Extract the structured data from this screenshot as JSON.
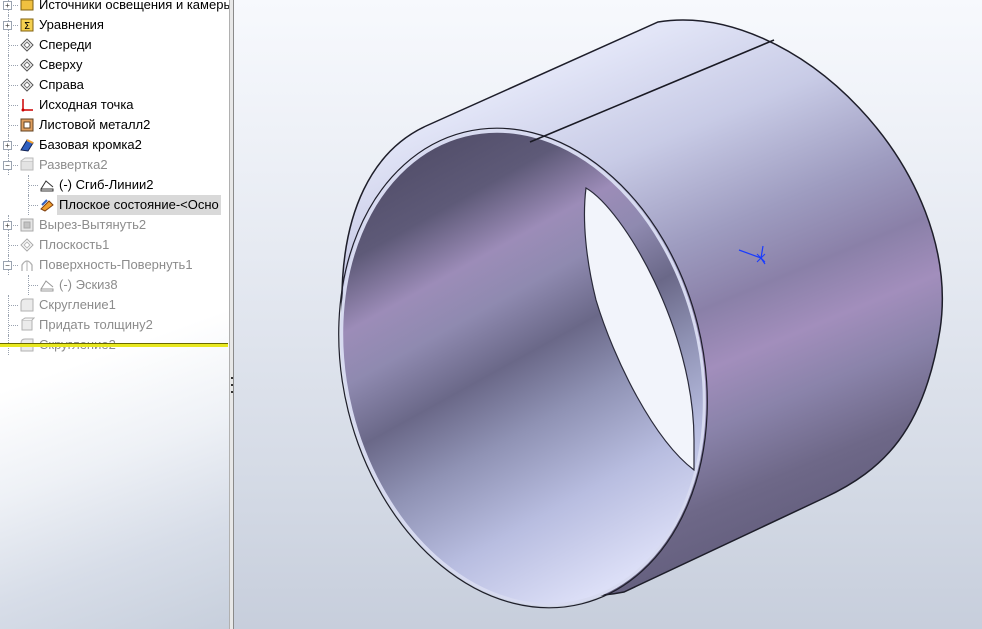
{
  "tree": {
    "items": [
      {
        "label": "Источники освещения и камеры",
        "icon": "folder-lights-icon",
        "expandable": true,
        "suppressed": false
      },
      {
        "label": "Уравнения",
        "icon": "equations-icon",
        "expandable": true,
        "suppressed": false
      },
      {
        "label": "Спереди",
        "icon": "plane-icon",
        "expandable": false,
        "suppressed": false
      },
      {
        "label": "Сверху",
        "icon": "plane-icon",
        "expandable": false,
        "suppressed": false
      },
      {
        "label": "Справа",
        "icon": "plane-icon",
        "expandable": false,
        "suppressed": false
      },
      {
        "label": "Исходная точка",
        "icon": "origin-icon",
        "expandable": false,
        "suppressed": false
      },
      {
        "label": "Листовой металл2",
        "icon": "sheet-metal-icon",
        "expandable": false,
        "suppressed": false
      },
      {
        "label": "Базовая кромка2",
        "icon": "base-flange-icon",
        "expandable": true,
        "suppressed": false
      },
      {
        "label": "Развертка2",
        "icon": "flatten-icon",
        "expandable": true,
        "expanded": true,
        "suppressed": true
      },
      {
        "label": "(-) Сгиб-Линии2",
        "icon": "sketch-icon",
        "expandable": false,
        "suppressed": false,
        "child": true
      },
      {
        "label": "Плоское состояние-<Осно",
        "icon": "flat-pattern-icon",
        "expandable": false,
        "suppressed": false,
        "child": true,
        "selected": true
      },
      {
        "label": "Вырез-Вытянуть2",
        "icon": "extruded-cut-icon",
        "expandable": true,
        "suppressed": true
      },
      {
        "label": "Плоскость1",
        "icon": "plane-icon",
        "expandable": false,
        "suppressed": true
      },
      {
        "label": "Поверхность-Повернуть1",
        "icon": "revolve-surface-icon",
        "expandable": true,
        "expanded": true,
        "suppressed": true
      },
      {
        "label": "(-) Эскиз8",
        "icon": "sketch-icon",
        "expandable": false,
        "suppressed": true,
        "child": true
      },
      {
        "label": "Скругление1",
        "icon": "fillet-icon",
        "expandable": false,
        "suppressed": true
      },
      {
        "label": "Придать толщину2",
        "icon": "thicken-icon",
        "expandable": false,
        "suppressed": true
      },
      {
        "label": "Скругление2",
        "icon": "fillet-icon",
        "expandable": false,
        "suppressed": true
      }
    ]
  },
  "colors": {
    "accent_rollback": "#e8e820",
    "model_light": "#d4d8f0",
    "model_mid": "#8a8cb0",
    "model_dark": "#5a5878",
    "model_purple": "#9d88b8",
    "triad_blue": "#1a3cff"
  },
  "viewport": {
    "model": "cylindrical-sheet-metal-part",
    "triad": "coordinate-triad-icon"
  }
}
